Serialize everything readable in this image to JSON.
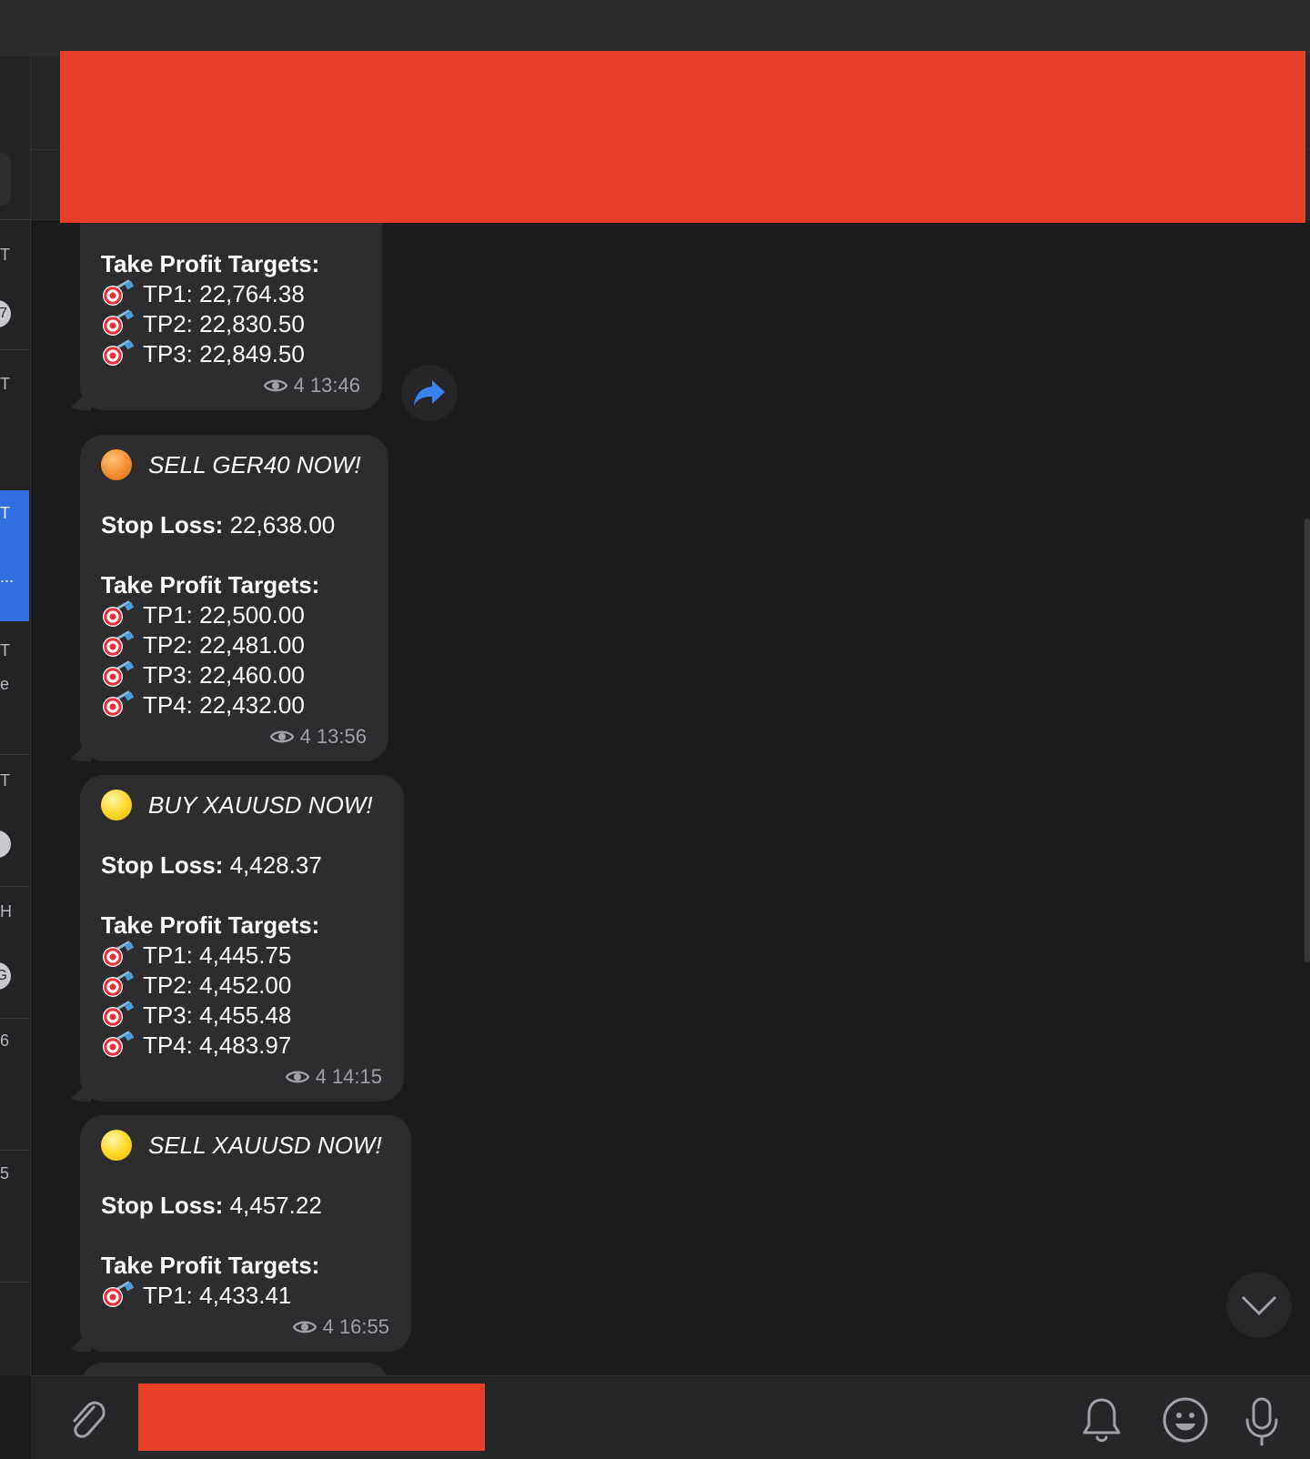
{
  "messages": [
    {
      "partial": true,
      "section_label": "Take Profit Targets:",
      "targets": [
        "TP1: 22,764.38",
        "TP2: 22,830.50",
        "TP3: 22,849.50"
      ],
      "views": "4",
      "time": "13:46"
    },
    {
      "signal_color": "orange",
      "headline": "SELL GER40 NOW!",
      "stop_loss_label": "Stop Loss:",
      "stop_loss_value": "22,638.00",
      "section_label": "Take Profit Targets:",
      "targets": [
        "TP1: 22,500.00",
        "TP2: 22,481.00",
        "TP3: 22,460.00",
        "TP4: 22,432.00"
      ],
      "views": "4",
      "time": "13:56"
    },
    {
      "signal_color": "yellow",
      "headline": "BUY XAUUSD NOW!",
      "stop_loss_label": "Stop Loss:",
      "stop_loss_value": "4,428.37",
      "section_label": "Take Profit Targets:",
      "targets": [
        "TP1: 4,445.75",
        "TP2: 4,452.00",
        "TP3: 4,455.48",
        "TP4: 4,483.97"
      ],
      "views": "4",
      "time": "14:15"
    },
    {
      "signal_color": "yellow",
      "headline": "SELL XAUUSD NOW!",
      "stop_loss_label": "Stop Loss:",
      "stop_loss_value": "4,457.22",
      "section_label": "Take Profit Targets:",
      "targets": [
        "TP1: 4,433.41"
      ],
      "views": "4",
      "time": "16:55"
    }
  ],
  "sidebar_fragments": [
    "T",
    "T",
    "T",
    "...",
    "T",
    "e",
    "T",
    "H",
    "6",
    "5"
  ],
  "sidebar_avatar_fragments": [
    "7",
    "",
    "G"
  ],
  "icons": {
    "forward": "forward-arrow-icon",
    "scroll_down": "chevron-down-icon",
    "attach": "paperclip-icon",
    "notifications": "bell-icon",
    "emoji": "smiley-icon",
    "voice": "microphone-icon",
    "views": "eye-icon",
    "target": "direct-hit-icon"
  },
  "colors": {
    "background": "#1c1c1e",
    "bubble": "#2d2d30",
    "accent": "#2f6fe0",
    "redaction": "#e84028",
    "meta_text": "#a0a0a6"
  }
}
